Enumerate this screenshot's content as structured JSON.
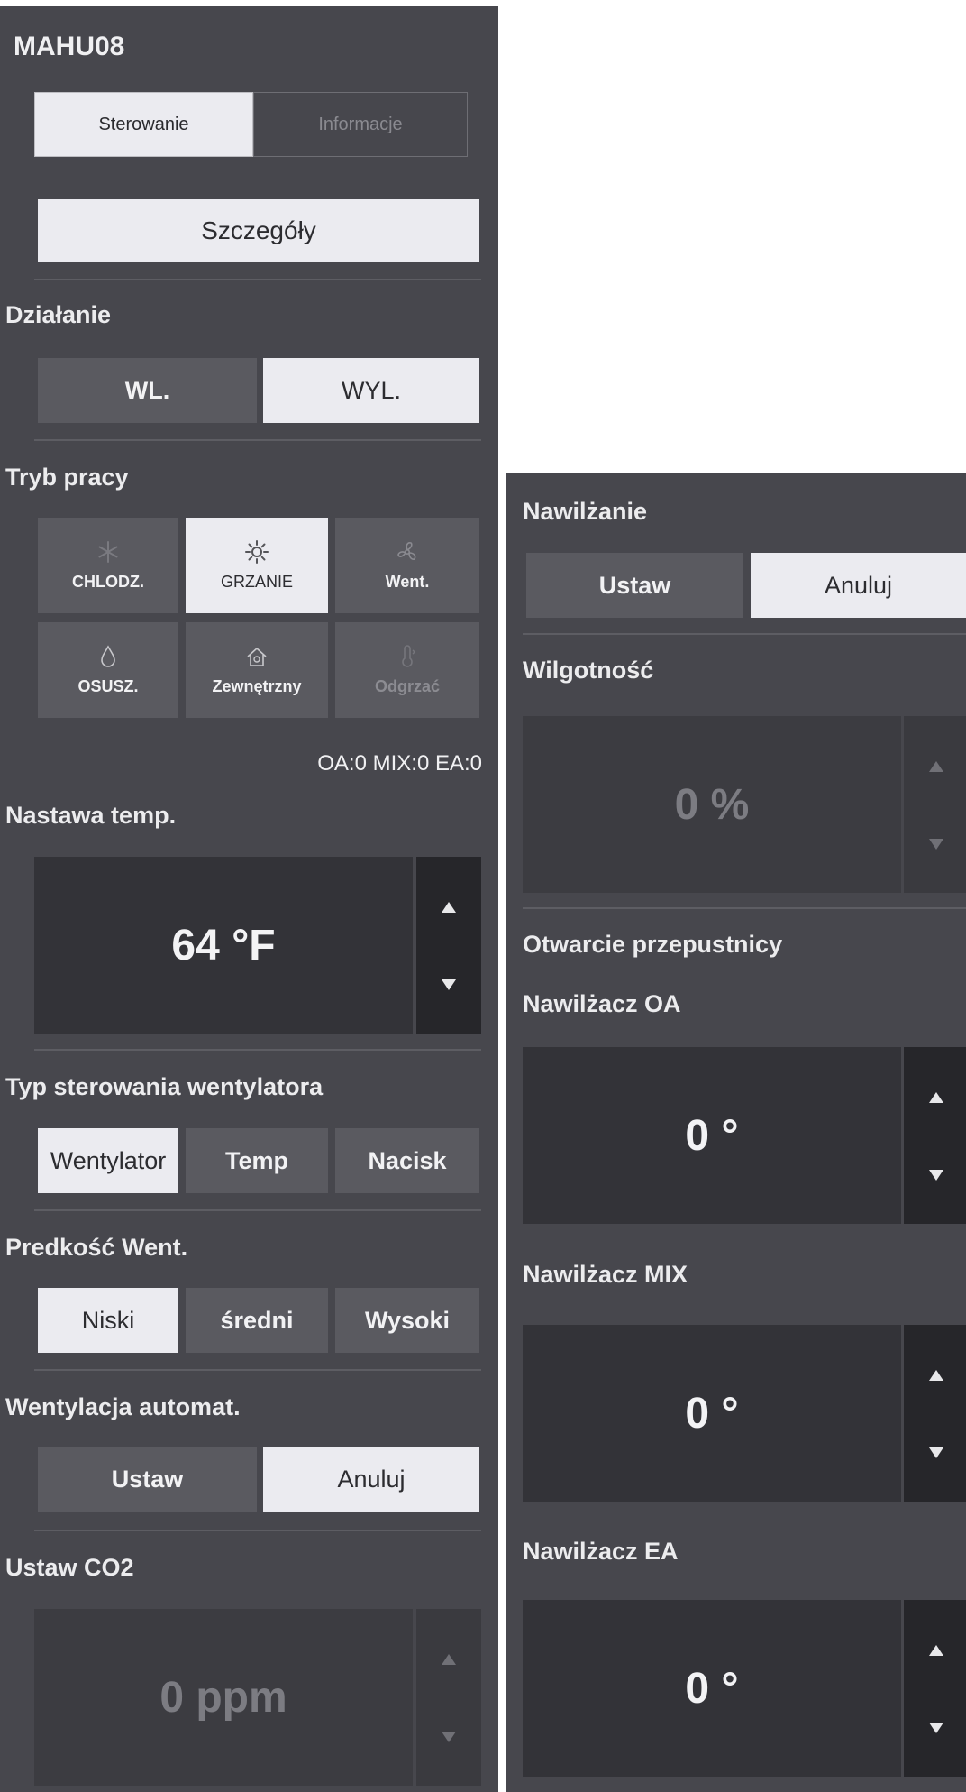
{
  "left_panel": {
    "title": "MAHU08",
    "tabs": [
      {
        "label": "Sterowanie",
        "active": true
      },
      {
        "label": "Informacje",
        "active": false
      }
    ],
    "details_button": "Szczegóły",
    "operation": {
      "label": "Działanie",
      "on": "WL.",
      "off": "WYL.",
      "selected": "off"
    },
    "mode": {
      "label": "Tryb pracy",
      "items": [
        {
          "label": "CHLODZ.",
          "icon": "snowflake-icon",
          "state": "normal"
        },
        {
          "label": "GRZANIE",
          "icon": "sun-icon",
          "state": "selected"
        },
        {
          "label": "Went.",
          "icon": "fan-icon",
          "state": "normal"
        },
        {
          "label": "OSUSZ.",
          "icon": "droplet-icon",
          "state": "normal"
        },
        {
          "label": "Zewnętrzny",
          "icon": "house-icon",
          "state": "normal"
        },
        {
          "label": "Odgrzać",
          "icon": "thermometer-icon",
          "state": "disabled"
        }
      ]
    },
    "damper_status": "OA:0 MIX:0 EA:0",
    "temp_setpoint": {
      "label": "Nastawa temp.",
      "value": "64 °F"
    },
    "fan_control_type": {
      "label": "Typ sterowania wentylatora",
      "options": [
        "Wentylator",
        "Temp",
        "Nacisk"
      ],
      "selected": "Wentylator"
    },
    "fan_speed": {
      "label": "Predkość Went.",
      "options": [
        "Niski",
        "średni",
        "Wysoki"
      ],
      "selected": "Niski"
    },
    "auto_ventilation": {
      "label": "Wentylacja automat.",
      "set": "Ustaw",
      "cancel": "Anuluj",
      "selected": "cancel"
    },
    "co2_setpoint": {
      "label": "Ustaw CO2",
      "value": "0 ppm"
    }
  },
  "right_panel": {
    "humidification": {
      "label": "Nawilżanie",
      "set": "Ustaw",
      "cancel": "Anuluj",
      "selected": "cancel"
    },
    "humidity": {
      "label": "Wilgotność",
      "value": "0 %"
    },
    "damper_opening": {
      "label": "Otwarcie przepustnicy",
      "oa": {
        "label": "Nawilżacz OA",
        "value": "0 °"
      },
      "mix": {
        "label": "Nawilżacz MIX",
        "value": "0 °"
      },
      "ea": {
        "label": "Nawilżacz EA",
        "value": "0 °"
      }
    }
  },
  "colors": {
    "panel_bg": "#47474d",
    "button_dark": "#5a5a60",
    "button_light": "#ebebf0",
    "value_box": "#333338",
    "stepper_bg": "#26262a"
  }
}
